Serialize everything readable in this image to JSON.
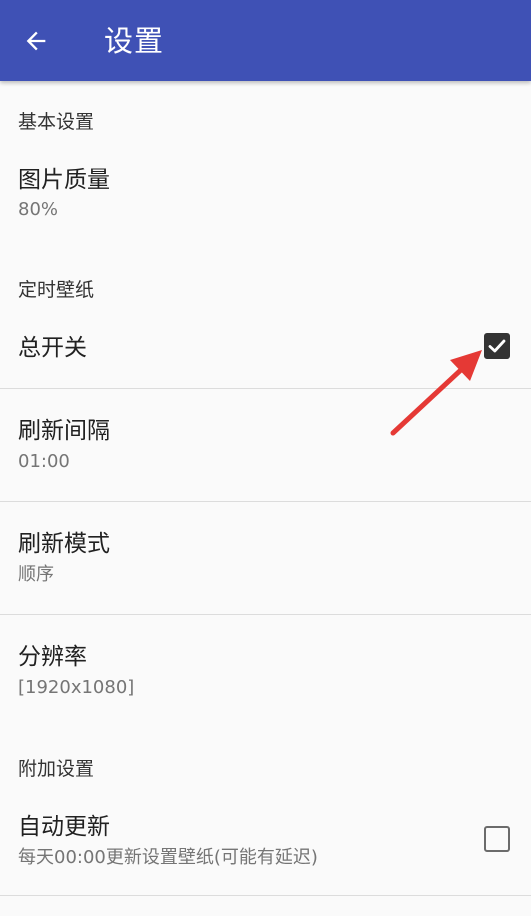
{
  "toolbar": {
    "title": "设置",
    "back_icon": "arrow-left-icon",
    "color": "#3f51b5"
  },
  "sections": {
    "basic": {
      "header": "基本设置",
      "image_quality": {
        "title": "图片质量",
        "summary": "80%"
      }
    },
    "timed_wallpaper": {
      "header": "定时壁纸",
      "master_switch": {
        "title": "总开关",
        "checked": true
      },
      "refresh_interval": {
        "title": "刷新间隔",
        "summary": "01:00"
      },
      "refresh_mode": {
        "title": "刷新模式",
        "summary": "顺序"
      },
      "resolution": {
        "title": "分辨率",
        "summary": "[1920x1080]"
      }
    },
    "extra": {
      "header": "附加设置",
      "auto_update": {
        "title": "自动更新",
        "summary": "每天00:00更新设置壁纸(可能有延迟)",
        "checked": false
      }
    }
  },
  "annotation": {
    "icon": "red-arrow-icon",
    "color": "#e53935"
  }
}
